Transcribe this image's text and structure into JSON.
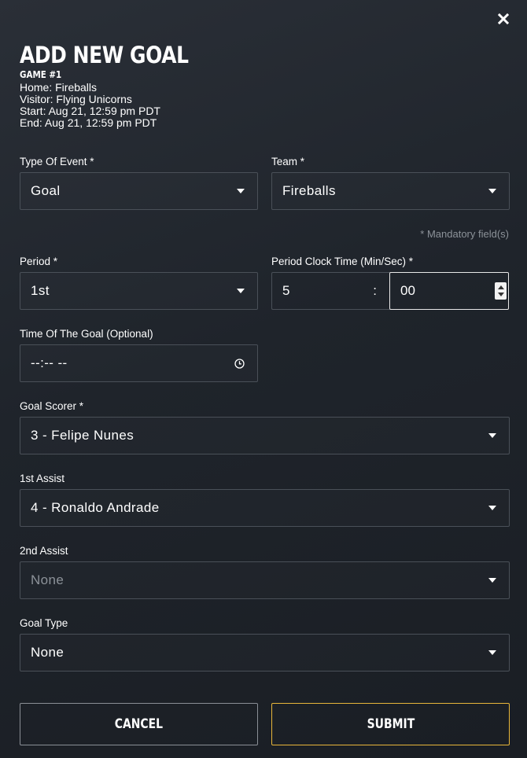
{
  "header": {
    "title": "ADD NEW GOAL",
    "game": "GAME #1",
    "home": "Home: Fireballs",
    "visitor": "Visitor: Flying Unicorns",
    "start": "Start: Aug 21, 12:59 pm PDT",
    "end": "End: Aug 21, 12:59 pm PDT"
  },
  "close_icon": "close-icon",
  "form": {
    "event_type": {
      "label": "Type Of Event *",
      "value": "Goal"
    },
    "team": {
      "label": "Team *",
      "value": "Fireballs"
    },
    "mandatory_note": "* Mandatory field(s)",
    "period": {
      "label": "Period *",
      "value": "1st"
    },
    "clock": {
      "label": "Period Clock Time (Min/Sec) *",
      "minutes": "5",
      "separator": ":",
      "seconds": "00"
    },
    "goal_time": {
      "label": "Time Of The Goal (Optional)",
      "placeholder": "--:-- --"
    },
    "scorer": {
      "label": "Goal Scorer *",
      "value": "3 - Felipe Nunes"
    },
    "assist1": {
      "label": "1st Assist",
      "value": "4 - Ronaldo Andrade"
    },
    "assist2": {
      "label": "2nd Assist",
      "value": "None"
    },
    "goal_type": {
      "label": "Goal Type",
      "value": "None"
    }
  },
  "buttons": {
    "cancel": "CANCEL",
    "submit": "SUBMIT"
  },
  "colors": {
    "background": "#22272e",
    "border": "#4a5058",
    "submit_border": "#e8b63a",
    "muted_text": "#8c9299"
  }
}
